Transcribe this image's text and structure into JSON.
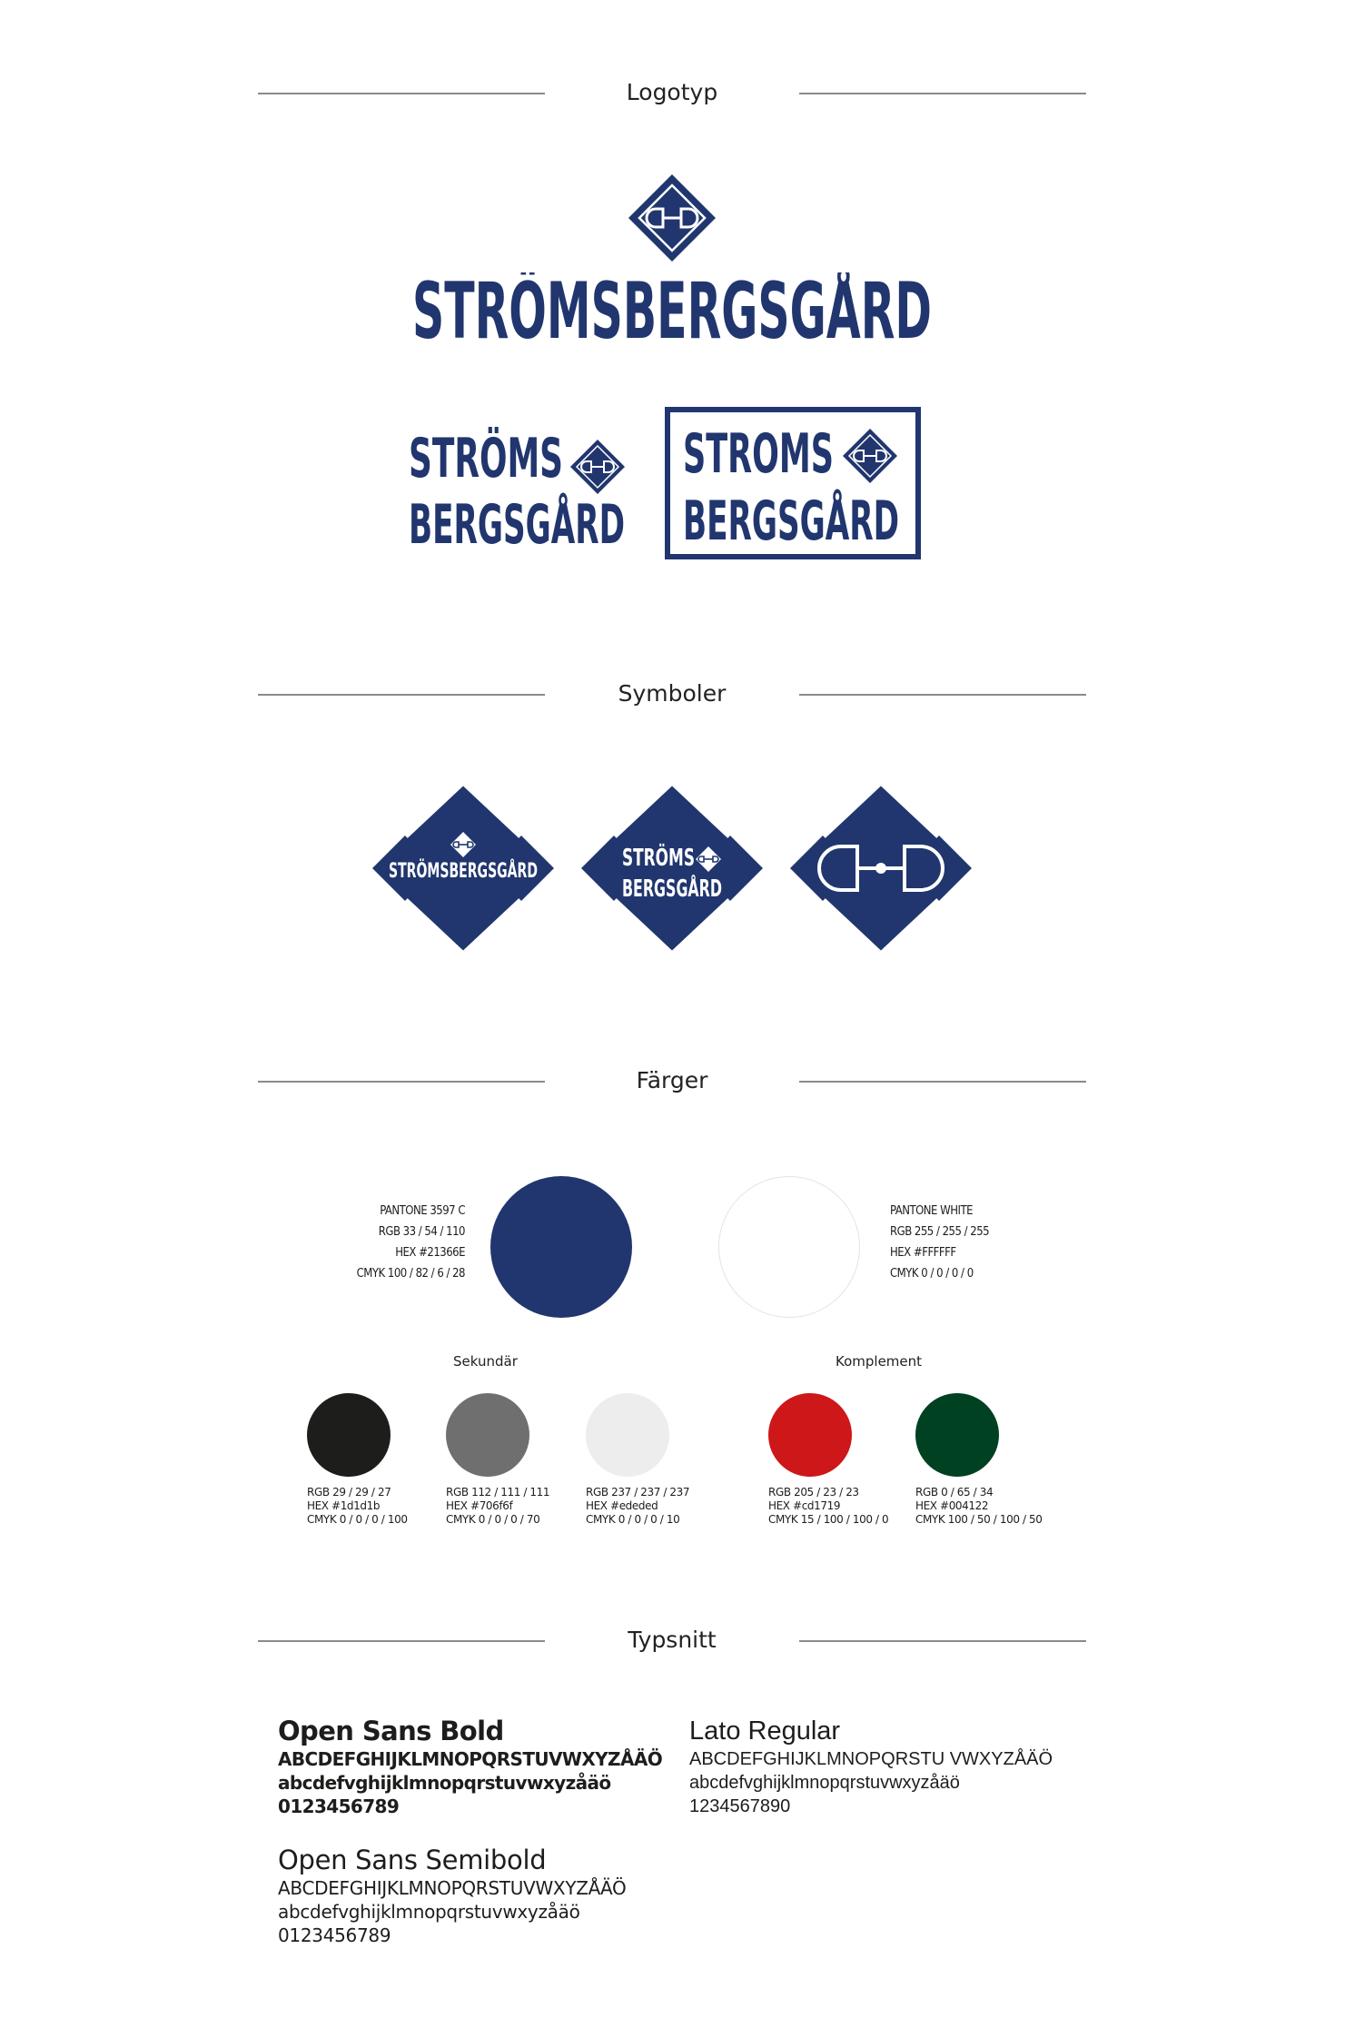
{
  "sections": {
    "logotyp": "Logotyp",
    "symboler": "Symboler",
    "farger": "Färger",
    "typsnitt": "Typsnitt"
  },
  "logo": {
    "wordmark": "STRÖMSBERGSGÅRD",
    "stacked_line1": "STRÖMS",
    "stacked_line2": "BERGSGÅRD",
    "boxed_line1": "STROMS",
    "boxed_line2": "BERGSGÅRD"
  },
  "symbols": {
    "badge1_text": "STRÖMSBERGSGÅRD",
    "badge2_line1": "STRÖMS",
    "badge2_line2": "BERGSGÅRD"
  },
  "colors": {
    "brand": "#21366e",
    "primary": {
      "color": "#21366e",
      "pantone": "PANTONE 3597 C",
      "rgb": "RGB 33 / 54 / 110",
      "hex": "HEX #21366E",
      "cmyk": "CMYK 100 / 82 / 6 / 28"
    },
    "white": {
      "color": "#ffffff",
      "pantone": "PANTONE WHITE",
      "rgb": "RGB 255 / 255 / 255",
      "hex": "HEX #FFFFFF",
      "cmyk": "CMYK 0  /  0  / 0 / 0"
    },
    "secondary_label": "Sekundär",
    "complement_label": "Komplement",
    "secondary": [
      {
        "color": "#1d1d1b",
        "rgb": "RGB 29 / 29 / 27",
        "hex": "HEX #1d1d1b",
        "cmyk": "CMYK 0 /  0  /  0 / 100"
      },
      {
        "color": "#706f6f",
        "rgb": "RGB 112 / 111 / 111",
        "hex": "HEX #706f6f",
        "cmyk": "CMYK 0 / 0 / 0 / 70"
      },
      {
        "color": "#ededed",
        "rgb": "RGB 237 / 237 / 237",
        "hex": "HEX #ededed",
        "cmyk": "CMYK 0 / 0 / 0 / 10"
      }
    ],
    "complement": [
      {
        "color": "#cd1719",
        "rgb": "RGB 205 / 23 / 23",
        "hex": "HEX #cd1719",
        "cmyk": "CMYK 15 / 100 / 100 / 0"
      },
      {
        "color": "#004122",
        "rgb": "RGB 0 / 65 / 34",
        "hex": "HEX #004122",
        "cmyk": "CMYK 100 / 50 / 100 / 50"
      }
    ]
  },
  "fonts": {
    "open_sans_bold": {
      "name": "Open Sans Bold",
      "upper": "ABCDEFGHIJKLMNOPQRSTUVWXYZÅÄÖ",
      "lower": "abcdefvghijklmnopqrstuvwxyzåäö",
      "digits": "0123456789"
    },
    "open_sans_semibold": {
      "name": "Open Sans Semibold",
      "upper": "ABCDEFGHIJKLMNOPQRSTUVWXYZÅÄÖ",
      "lower": "abcdefvghijklmnopqrstuvwxyzåäö",
      "digits": "0123456789"
    },
    "lato_regular": {
      "name": "Lato Regular",
      "upper": "ABCDEFGHIJKLMNOPQRSTU VWXYZÅÄÖ",
      "lower": "abcdefvghijklmnopqrstuvwxyzåäö",
      "digits": "1234567890"
    }
  }
}
